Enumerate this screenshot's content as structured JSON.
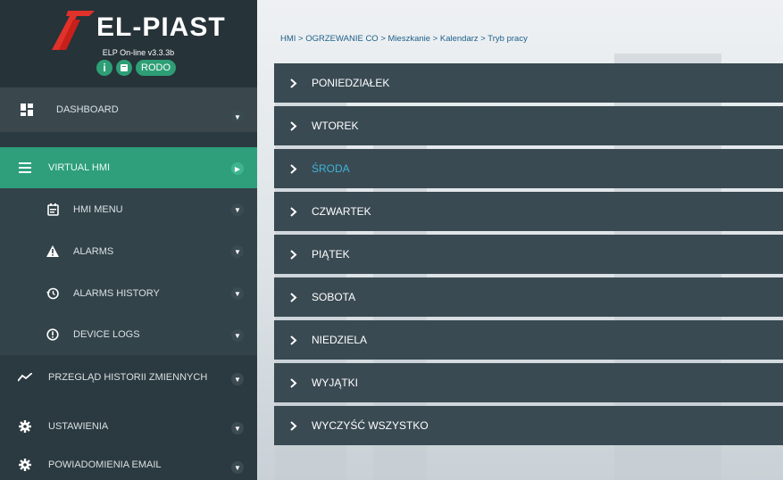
{
  "app": {
    "logo_text": "EL-PIAST",
    "version": "ELP On-line v3.3.3b",
    "info_icon": "i",
    "rodo_label": "RODO",
    "accent_color": "#2e9f7a"
  },
  "sidebar": {
    "dashboard": {
      "label": "DASHBOARD",
      "icon": "dashboard-icon"
    },
    "virtual_hmi": {
      "label": "VIRTUAL HMI",
      "icon": "menu-icon"
    },
    "hmi_menu": {
      "label": "HMI MENU",
      "icon": "calendar-icon"
    },
    "alarms": {
      "label": "ALARMS",
      "icon": "warning-icon"
    },
    "alarms_history": {
      "label": "ALARMS HISTORY",
      "icon": "history-icon"
    },
    "device_logs": {
      "label": "DEVICE LOGS",
      "icon": "info-circle-icon"
    },
    "history": {
      "label": "PRZEGLĄD HISTORII ZMIENNYCH",
      "icon": "trend-icon"
    },
    "settings": {
      "label": "USTAWIENIA",
      "icon": "gear-icon"
    },
    "email": {
      "label": "POWIADOMIENIA EMAIL",
      "icon": "gear-icon"
    }
  },
  "main": {
    "breadcrumb": "HMI > OGRZEWANIE CO > Mieszkanie > Kalendarz > Tryb pracy",
    "days": [
      {
        "label": "PONIEDZIAŁEK",
        "active": false
      },
      {
        "label": "WTOREK",
        "active": false
      },
      {
        "label": "ŚRODA",
        "active": true
      },
      {
        "label": "CZWARTEK",
        "active": false
      },
      {
        "label": "PIĄTEK",
        "active": false
      },
      {
        "label": "SOBOTA",
        "active": false
      },
      {
        "label": "NIEDZIELA",
        "active": false
      },
      {
        "label": "WYJĄTKI",
        "active": false
      },
      {
        "label": "WYCZYŚĆ WSZYSTKO",
        "active": false
      }
    ]
  }
}
